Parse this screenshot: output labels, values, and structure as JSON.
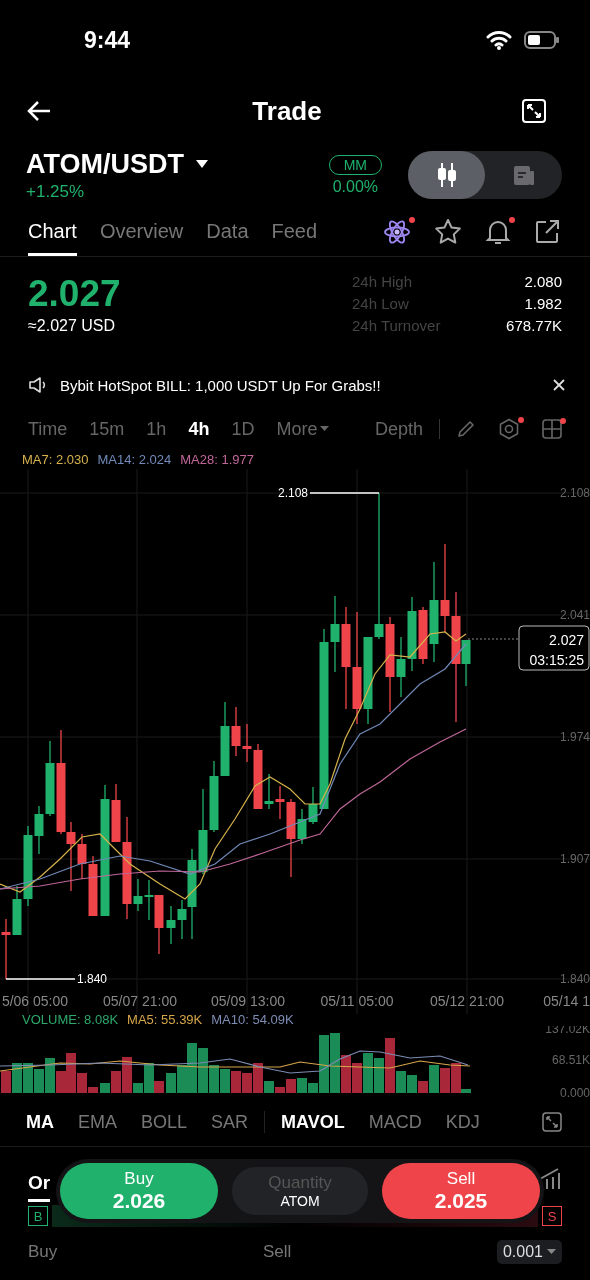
{
  "status_bar": {
    "time": "9:44"
  },
  "header": {
    "title": "Trade"
  },
  "pair": {
    "symbol": "ATOM/USDT",
    "change": "+1.25%",
    "mm_badge": "MM",
    "mm_rate": "0.00%",
    "view_toggle": [
      {
        "kind": "candles",
        "selected": true
      },
      {
        "kind": "document",
        "selected": false
      }
    ]
  },
  "tabs": [
    {
      "label": "Chart",
      "selected": true
    },
    {
      "label": "Overview",
      "selected": false
    },
    {
      "label": "Data",
      "selected": false
    },
    {
      "label": "Feed",
      "selected": false
    }
  ],
  "tab_icons": [
    {
      "kind": "atom",
      "dot": true
    },
    {
      "kind": "star"
    },
    {
      "kind": "bell",
      "dot": true
    },
    {
      "kind": "share"
    }
  ],
  "price": {
    "last": "2.027",
    "fiat": "≈2.027 USD"
  },
  "stats": [
    {
      "label": "24h High",
      "value": "2.080"
    },
    {
      "label": "24h Low",
      "value": "1.982"
    },
    {
      "label": "24h Turnover",
      "value": "678.77K"
    }
  ],
  "announcement": {
    "text": "Bybit HotSpot BILL: 1,000 USDT Up For Grabs!!"
  },
  "intervals": [
    {
      "label": "Time",
      "selected": false
    },
    {
      "label": "15m",
      "selected": false
    },
    {
      "label": "1h",
      "selected": false
    },
    {
      "label": "4h",
      "selected": true
    },
    {
      "label": "1D",
      "selected": false
    },
    {
      "label": "More",
      "selected": false,
      "caret": true
    }
  ],
  "depth": "Depth",
  "tool_icons": [
    {
      "kind": "pencil"
    },
    {
      "kind": "gear",
      "dot": true
    },
    {
      "kind": "grid",
      "dot": true
    }
  ],
  "ma_legend": [
    {
      "label": "MA7: 2.030",
      "color": "#d6b24c"
    },
    {
      "label": "MA14: 2.024",
      "color": "#7189b8"
    },
    {
      "label": "MA28: 1.977",
      "color": "#c0679a"
    }
  ],
  "chart": {
    "high_marker": "2.108",
    "low_marker": "1.840",
    "y_labels": [
      "2.108",
      "2.041",
      "1.974",
      "1.907",
      "1.840"
    ],
    "x_labels": [
      "5/06 05:00",
      "05/07 21:00",
      "05/09 13:00",
      "05/11 05:00",
      "05/12 21:00",
      "05/14 1"
    ],
    "last_price": "2.027",
    "countdown": "03:15:25"
  },
  "volume_legend": [
    {
      "label": "VOLUME: 8.08K",
      "color": "#2ea86b"
    },
    {
      "label": "MA5: 55.39K",
      "color": "#d6a64a"
    },
    {
      "label": "MA10: 54.09K",
      "color": "#7d8cb4"
    }
  ],
  "volume_axis": [
    "137.02K",
    "68.51K",
    "0.000"
  ],
  "indicators": {
    "main": [
      {
        "label": "MA",
        "selected": true
      },
      {
        "label": "EMA",
        "selected": false
      },
      {
        "label": "BOLL",
        "selected": false
      },
      {
        "label": "SAR",
        "selected": false
      }
    ],
    "sub": [
      {
        "label": "MAVOL",
        "selected": true
      },
      {
        "label": "MACD",
        "selected": false
      },
      {
        "label": "KDJ",
        "selected": false
      }
    ]
  },
  "order_tab": {
    "label": "Or",
    "selected": true
  },
  "trade_bar": {
    "buy_label": "Buy",
    "buy_price": "2.026",
    "quantity_placeholder": "Quantity",
    "quantity_unit": "ATOM",
    "sell_label": "Sell",
    "sell_price": "2.025"
  },
  "book": {
    "buy_badge": "B",
    "sell_badge": "S",
    "buy_header": "Buy",
    "sell_header": "Sell",
    "precision": "0.001"
  }
}
